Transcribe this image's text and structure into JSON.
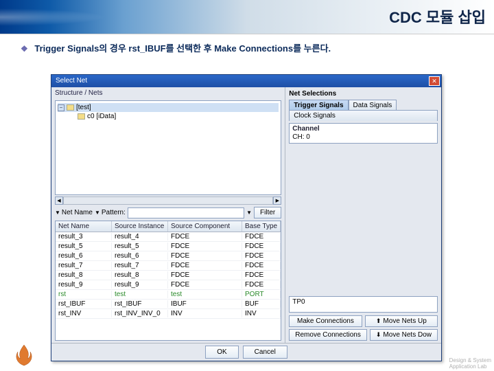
{
  "slide": {
    "title": "CDC 모듈 삽입",
    "bullet": "Trigger Signals의 경우 rst_IBUF를 선택한 후 Make Connections를 누른다."
  },
  "dialog": {
    "title": "Select Net",
    "breadcrumb": "Structure / Nets",
    "tree": {
      "root_label": "[test]",
      "child_label": "c0 [iData]"
    },
    "filter": {
      "net_name_label": "Net Name",
      "pattern_label": "Pattern:",
      "filter_button": "Filter"
    },
    "columns": [
      "Net Name",
      "Source Instance",
      "Source Component",
      "Base Type"
    ],
    "rows": [
      {
        "net": "result_3",
        "inst": "result_4",
        "comp": "FDCE",
        "type": "FDCE"
      },
      {
        "net": "result_5",
        "inst": "result_5",
        "comp": "FDCE",
        "type": "FDCE"
      },
      {
        "net": "result_6",
        "inst": "result_6",
        "comp": "FDCE",
        "type": "FDCE"
      },
      {
        "net": "result_7",
        "inst": "result_7",
        "comp": "FDCE",
        "type": "FDCE"
      },
      {
        "net": "result_8",
        "inst": "result_8",
        "comp": "FDCE",
        "type": "FDCE"
      },
      {
        "net": "result_9",
        "inst": "result_9",
        "comp": "FDCE",
        "type": "FDCE"
      },
      {
        "net": "rst",
        "inst": "test",
        "comp": "test",
        "type": "PORT"
      },
      {
        "net": "rst_IBUF",
        "inst": "rst_IBUF",
        "comp": "IBUF",
        "type": "BUF"
      },
      {
        "net": "rst_INV",
        "inst": "rst_INV_INV_0",
        "comp": "INV",
        "type": "INV"
      }
    ],
    "highlight_row": 6,
    "right": {
      "title": "Net Selections",
      "tabs": [
        "Trigger Signals",
        "Data Signals"
      ],
      "tab2": "Clock Signals",
      "channel_label": "Channel",
      "channel_item": "CH: 0",
      "tp_label": "TP0",
      "buttons": {
        "make": "Make Connections",
        "move_up": "Move Nets Up",
        "remove": "Remove Connections",
        "move_down": "Move Nets Dow"
      }
    },
    "footer": {
      "ok": "OK",
      "cancel": "Cancel"
    }
  },
  "watermark": "Design & System\\nApplication Lab"
}
